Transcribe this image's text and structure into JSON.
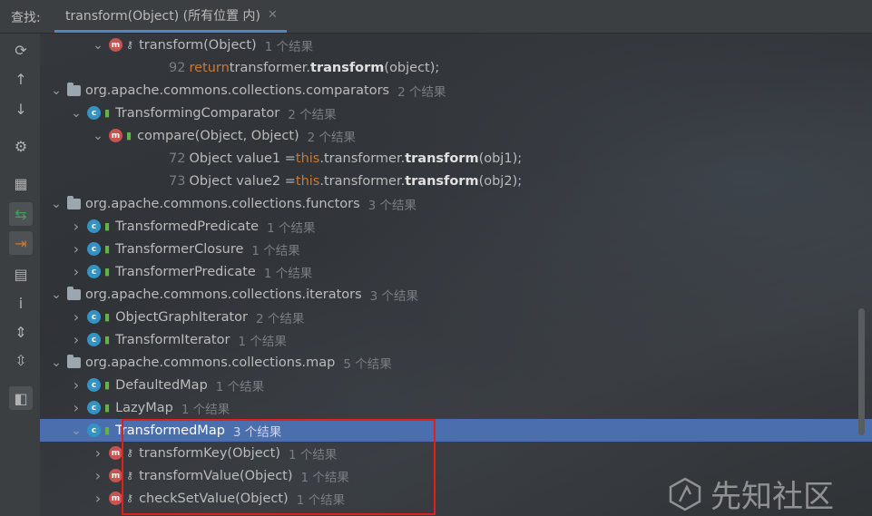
{
  "header": {
    "find_label": "查找:",
    "tab_label": "transform(Object) (所有位置 内)",
    "tab_close": "✕"
  },
  "toolbar": [
    {
      "name": "refresh-icon",
      "glyph": "⟳"
    },
    {
      "name": "arrow-up-icon",
      "glyph": "↑"
    },
    {
      "name": "arrow-down-icon",
      "glyph": "↓"
    },
    {
      "name": "gear-icon",
      "glyph": "⚙"
    },
    {
      "name": "group-by-icon",
      "glyph": "▦"
    },
    {
      "name": "read-access-icon",
      "glyph": "⇆"
    },
    {
      "name": "write-access-icon",
      "glyph": "⇥"
    },
    {
      "name": "folder-filter-icon",
      "glyph": "▤"
    },
    {
      "name": "info-icon",
      "glyph": "i"
    },
    {
      "name": "expand-all-icon",
      "glyph": "⇕"
    },
    {
      "name": "collapse-all-icon",
      "glyph": "⇳"
    },
    {
      "name": "preview-icon",
      "glyph": "◧"
    }
  ],
  "tree": [
    {
      "indent": 120,
      "expand": "v",
      "icon": "m",
      "vis": "key",
      "label": "transform(Object)",
      "count": "1 个结果"
    },
    {
      "indent": 186,
      "code": true,
      "ln": "92",
      "parts": [
        [
          "kw",
          "return "
        ],
        [
          "plain",
          "transformer."
        ],
        [
          "bold",
          "transform"
        ],
        [
          "plain",
          "(object);"
        ]
      ]
    },
    {
      "indent": 74,
      "expand": "v",
      "icon": "pkg",
      "label": "org.apache.commons.collections.comparators",
      "count": "2 个结果"
    },
    {
      "indent": 96,
      "expand": "v",
      "icon": "c",
      "vis": "lock",
      "label": "TransformingComparator",
      "count": "2 个结果"
    },
    {
      "indent": 120,
      "expand": "v",
      "icon": "m",
      "vis": "lock",
      "label": "compare(Object, Object)",
      "count": "2 个结果"
    },
    {
      "indent": 186,
      "code": true,
      "ln": "72",
      "parts": [
        [
          "plain",
          "Object value1 = "
        ],
        [
          "kw",
          "this"
        ],
        [
          "plain",
          ".transformer."
        ],
        [
          "bold",
          "transform"
        ],
        [
          "plain",
          "(obj1);"
        ]
      ]
    },
    {
      "indent": 186,
      "code": true,
      "ln": "73",
      "parts": [
        [
          "plain",
          "Object value2 = "
        ],
        [
          "kw",
          "this"
        ],
        [
          "plain",
          ".transformer."
        ],
        [
          "bold",
          "transform"
        ],
        [
          "plain",
          "(obj2);"
        ]
      ]
    },
    {
      "indent": 74,
      "expand": "v",
      "icon": "pkg",
      "label": "org.apache.commons.collections.functors",
      "count": "3 个结果"
    },
    {
      "indent": 96,
      "expand": ">",
      "icon": "c",
      "vis": "lock",
      "label": "TransformedPredicate",
      "count": "1 个结果"
    },
    {
      "indent": 96,
      "expand": ">",
      "icon": "c",
      "vis": "lock",
      "label": "TransformerClosure",
      "count": "1 个结果"
    },
    {
      "indent": 96,
      "expand": ">",
      "icon": "c",
      "vis": "lock",
      "label": "TransformerPredicate",
      "count": "1 个结果"
    },
    {
      "indent": 74,
      "expand": "v",
      "icon": "pkg",
      "label": "org.apache.commons.collections.iterators",
      "count": "3 个结果"
    },
    {
      "indent": 96,
      "expand": ">",
      "icon": "c",
      "vis": "lock",
      "label": "ObjectGraphIterator",
      "count": "2 个结果"
    },
    {
      "indent": 96,
      "expand": ">",
      "icon": "c",
      "vis": "lock",
      "label": "TransformIterator",
      "count": "1 个结果"
    },
    {
      "indent": 74,
      "expand": "v",
      "icon": "pkg",
      "label": "org.apache.commons.collections.map",
      "count": "5 个结果"
    },
    {
      "indent": 96,
      "expand": ">",
      "icon": "c",
      "vis": "lock",
      "label": "DefaultedMap",
      "count": "1 个结果"
    },
    {
      "indent": 96,
      "expand": ">",
      "icon": "c",
      "vis": "lock",
      "label": "LazyMap",
      "count": "1 个结果"
    },
    {
      "indent": 96,
      "expand": "v",
      "icon": "c",
      "vis": "lock",
      "label": "TransformedMap",
      "count": "3 个结果",
      "selected": true
    },
    {
      "indent": 120,
      "expand": ">",
      "icon": "m",
      "vis": "key",
      "label": "transformKey(Object)",
      "count": "1 个结果"
    },
    {
      "indent": 120,
      "expand": ">",
      "icon": "m",
      "vis": "key",
      "label": "transformValue(Object)",
      "count": "1 个结果"
    },
    {
      "indent": 120,
      "expand": ">",
      "icon": "m",
      "vis": "key",
      "label": "checkSetValue(Object)",
      "count": "1 个结果"
    }
  ],
  "watermark": {
    "text": "先知社区"
  }
}
